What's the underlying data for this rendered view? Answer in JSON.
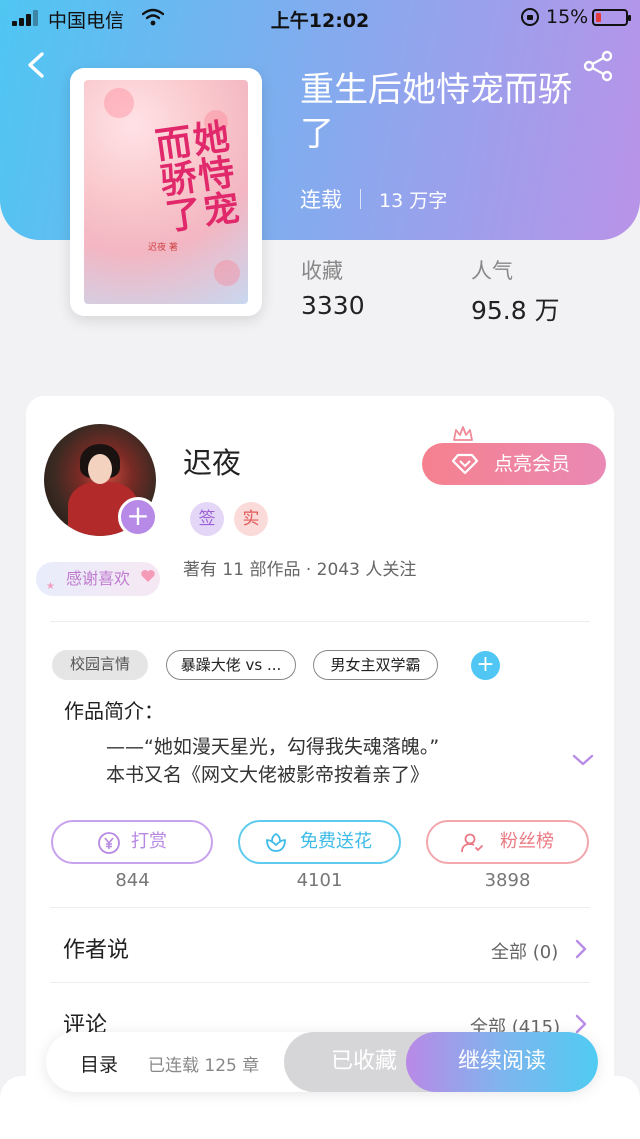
{
  "status_bar": {
    "carrier": "中国电信",
    "time": "上午12:02",
    "battery": "15%"
  },
  "colors": {
    "header_gradient": [
      "#4fc6f3",
      "#8aa8ee",
      "#b993e8"
    ],
    "vip": "#f5818e",
    "reward": "#b789e3",
    "flower": "#3dbbe8",
    "fans": "#ea7a83"
  },
  "book": {
    "title": "重生后她恃宠而骄了",
    "status": "连载",
    "word_count": "13 万字",
    "cover_title": "她恃宠而骄了",
    "cover_author": "迟夜 著",
    "stats": [
      {
        "label": "收藏",
        "value": "3330"
      },
      {
        "label": "人气",
        "value": "95.8 万"
      }
    ]
  },
  "author": {
    "name": "迟夜",
    "vip_label": "点亮会员",
    "badges": [
      "签",
      "实"
    ],
    "summary": "著有 11 部作品 · 2043 人关注",
    "thanks_label": "感谢喜欢"
  },
  "tags": [
    "校园言情",
    "暴躁大佬 vs ...",
    "男女主双学霸"
  ],
  "intro": {
    "title": "作品简介：",
    "line1": "——“她如漫天星光，勾得我失魂落魄。”",
    "line2": "本书又名《网文大佬被影帝按着亲了》"
  },
  "actions": [
    {
      "label": "打赏",
      "count": "844",
      "icon": "yuan-icon"
    },
    {
      "label": "免费送花",
      "count": "4101",
      "icon": "flower-icon"
    },
    {
      "label": "粉丝榜",
      "count": "3898",
      "icon": "fan-user-icon"
    }
  ],
  "sections": {
    "author_says": {
      "title": "作者说",
      "link": "全部 (0)"
    },
    "comments": {
      "title": "评论",
      "link": "全部 (415)"
    }
  },
  "bottom": {
    "toc": "目录",
    "serial": "已连载 125 章",
    "collected": "已收藏",
    "continue": "继续阅读"
  }
}
